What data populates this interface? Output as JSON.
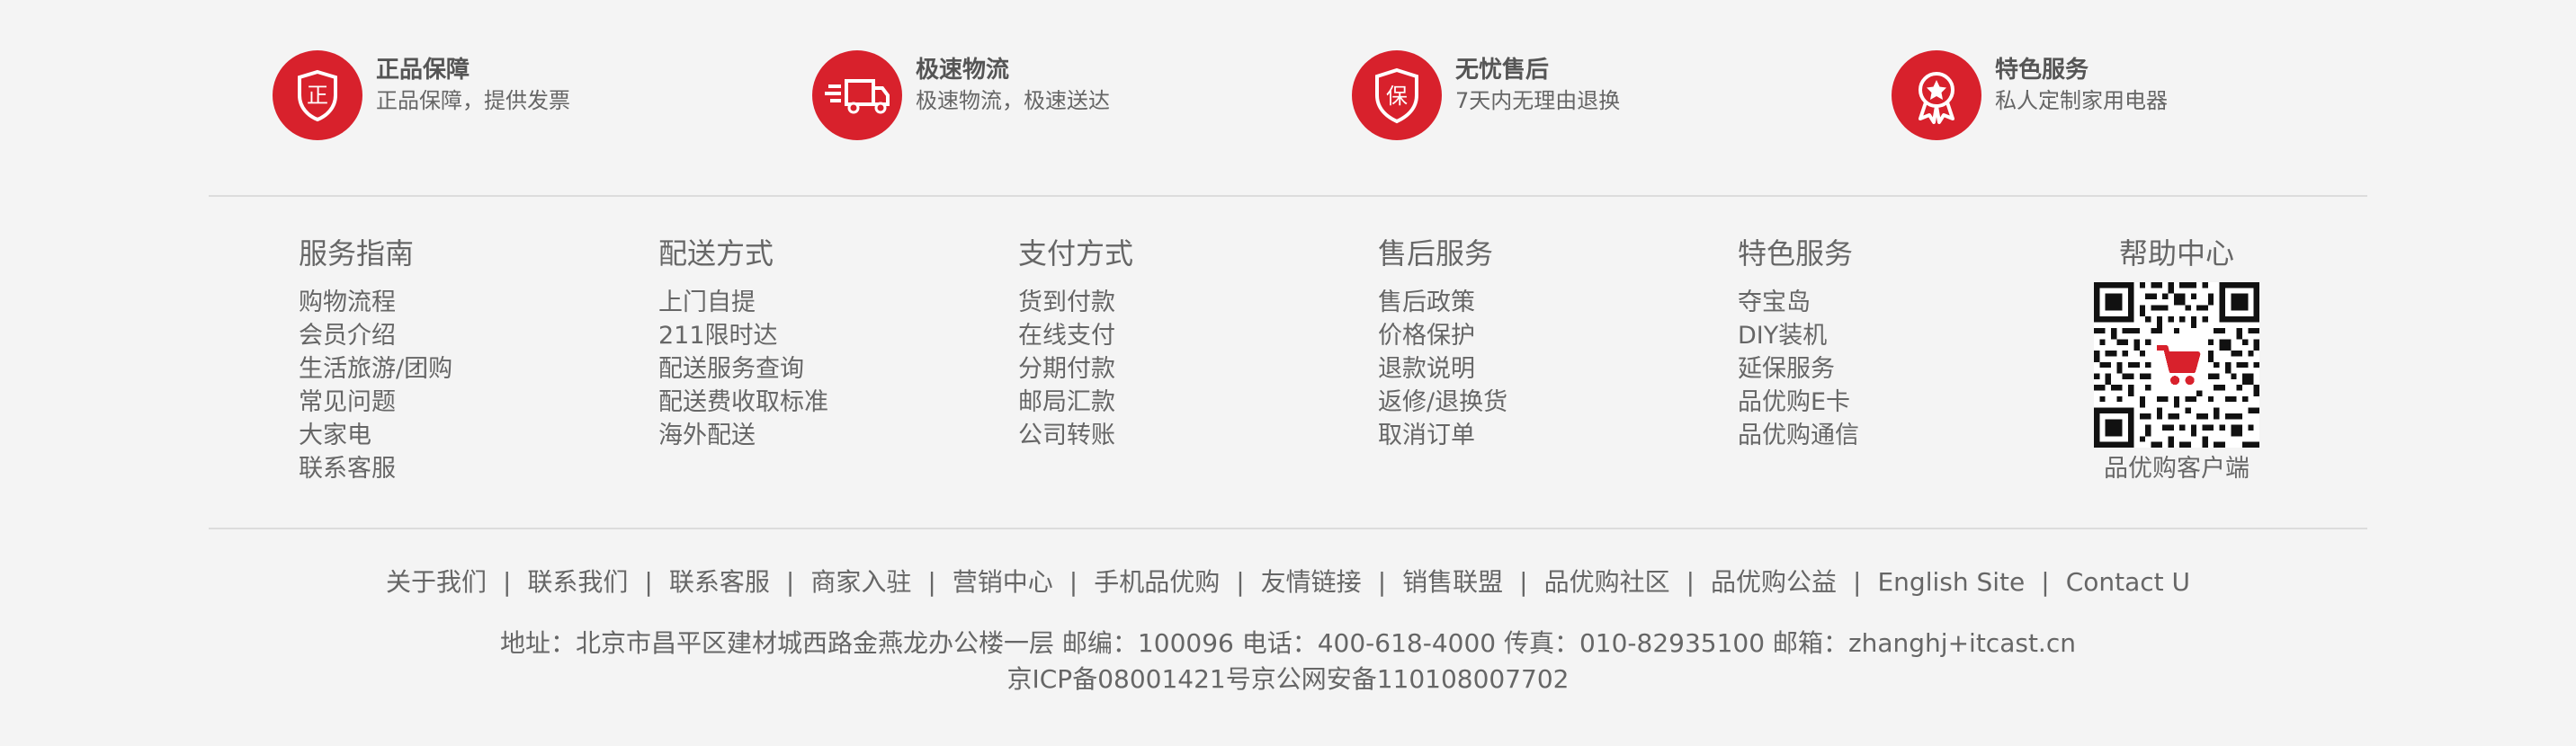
{
  "promises": [
    {
      "title": "正品保障",
      "desc": "正品保障，提供发票",
      "icon": "authentic-shield-icon"
    },
    {
      "title": "极速物流",
      "desc": "极速物流，极速送达",
      "icon": "delivery-truck-icon"
    },
    {
      "title": "无忧售后",
      "desc": "7天内无理由退换",
      "icon": "guarantee-shield-icon"
    },
    {
      "title": "特色服务",
      "desc": "私人定制家用电器",
      "icon": "award-medal-icon"
    }
  ],
  "help_columns": [
    {
      "title": "服务指南",
      "links": [
        "购物流程",
        "会员介绍",
        "生活旅游/团购",
        "常见问题",
        "大家电",
        "联系客服"
      ]
    },
    {
      "title": "配送方式",
      "links": [
        "上门自提",
        "211限时达",
        "配送服务查询",
        "配送费收取标准",
        "海外配送"
      ]
    },
    {
      "title": "支付方式",
      "links": [
        "货到付款",
        "在线支付",
        "分期付款",
        "邮局汇款",
        "公司转账"
      ]
    },
    {
      "title": "售后服务",
      "links": [
        "售后政策",
        "价格保护",
        "退款说明",
        "返修/退换货",
        "取消订单"
      ]
    },
    {
      "title": "特色服务",
      "links": [
        "夺宝岛",
        "DIY装机",
        "延保服务",
        "品优购E卡",
        "品优购通信"
      ]
    }
  ],
  "help_center": {
    "title": "帮助中心",
    "qr_caption": "品优购客户端",
    "qr_icon": "qr-code-icon",
    "cart_icon": "shopping-cart-icon"
  },
  "footer_links": [
    "关于我们",
    "联系我们",
    "联系客服",
    "商家入驻",
    "营销中心",
    "手机品优购",
    "友情链接",
    "销售联盟",
    "品优购社区",
    "品优购公益",
    "English Site",
    "Contact U"
  ],
  "footer_separator": "|",
  "copyright": {
    "address_line": "地址：北京市昌平区建材城西路金燕龙办公楼一层 邮编：100096 电话：400-618-4000 传真：010-82935100 邮箱：zhanghj+itcast.cn",
    "icp_line": "京ICP备08001421号京公网安备110108007702"
  },
  "colors": {
    "brand_red": "#d8212c",
    "background": "#f4f4f4",
    "text": "#666666",
    "divider": "#dcdcdc"
  }
}
